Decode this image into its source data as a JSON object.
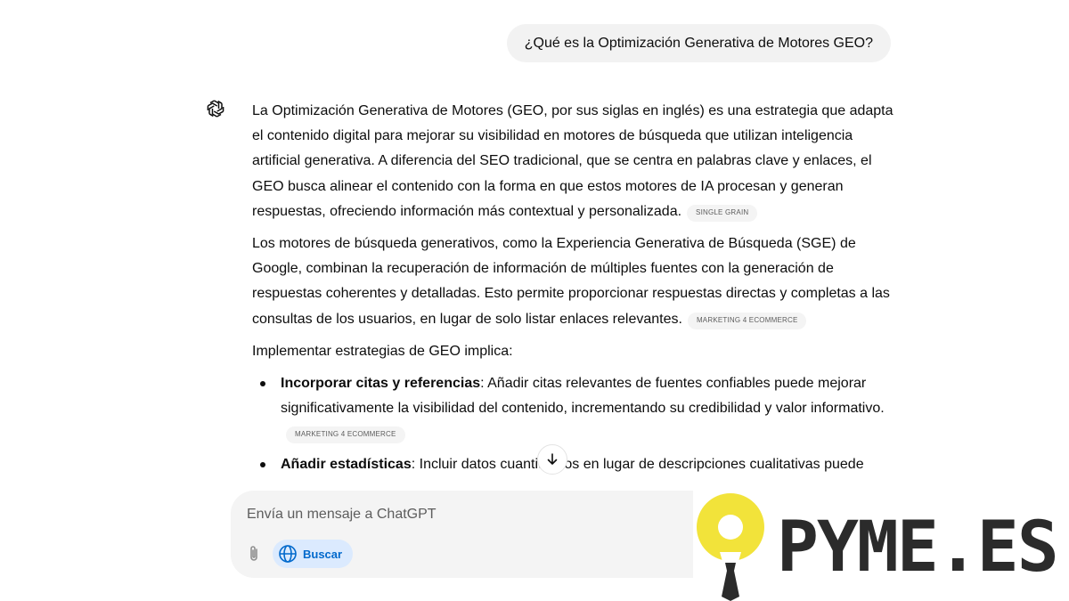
{
  "user_message": "¿Qué es la Optimización Generativa de Motores GEO?",
  "assistant": {
    "avatar_icon": "openai-logo-icon",
    "paragraphs": [
      {
        "text": "La Optimización Generativa de Motores (GEO, por sus siglas en inglés) es una estrategia que adapta el contenido digital para mejorar su visibilidad en motores de búsqueda que utilizan inteligencia artificial generativa. A diferencia del SEO tradicional, que se centra en palabras clave y enlaces, el GEO busca alinear el contenido con la forma en que estos motores de IA procesan y generan respuestas, ofreciendo información más contextual y personalizada.",
        "citation": "SINGLE GRAIN"
      },
      {
        "text": "Los motores de búsqueda generativos, como la Experiencia Generativa de Búsqueda (SGE) de Google, combinan la recuperación de información de múltiples fuentes con la generación de respuestas coherentes y detalladas. Esto permite proporcionar respuestas directas y completas a las consultas de los usuarios, en lugar de solo listar enlaces relevantes.",
        "citation": "MARKETING 4 ECOMMERCE"
      },
      {
        "text": "Implementar estrategias de GEO implica:"
      }
    ],
    "bullets": [
      {
        "title": "Incorporar citas y referencias",
        "text": ": Añadir citas relevantes de fuentes confiables puede mejorar significativamente la visibilidad del contenido, incrementando su credibilidad y valor informativo.",
        "citation": "MARKETING 4 ECOMMERCE"
      },
      {
        "title": "Añadir estadísticas",
        "text": ": Incluir datos cuantitativos en lugar de descripciones cualitativas puede"
      }
    ]
  },
  "composer": {
    "placeholder": "Envía un mensaje a ChatGPT",
    "attach_icon": "paperclip-icon",
    "search_icon": "globe-icon",
    "search_label": "Buscar"
  },
  "scroll_icon": "arrow-down-icon",
  "brand": {
    "name": "PYME.ES",
    "logo_colors": {
      "bulb": "#f2e33a",
      "tie": "#2b2b2b",
      "text": "#2b2b2b"
    }
  }
}
